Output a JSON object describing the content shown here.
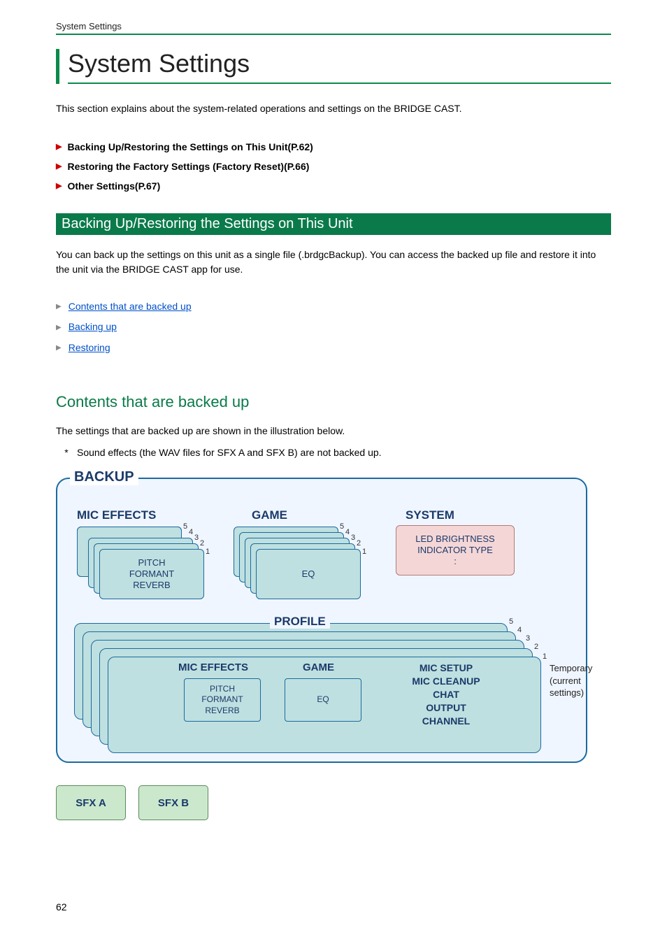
{
  "header": {
    "label": "System Settings"
  },
  "title": "System Settings",
  "intro": "This section explains about the system-related operations and settings on the BRIDGE CAST.",
  "toc": [
    "Backing Up/Restoring the Settings on This Unit(P.62)",
    "Restoring the Factory Settings (Factory Reset)(P.66)",
    "Other Settings(P.67)"
  ],
  "section1": {
    "bar": "Backing Up/Restoring the Settings on This Unit",
    "body": "You can back up the settings on this unit as a single file (.brdgcBackup). You can access the backed up file and restore it into the unit via the BRIDGE CAST app for use.",
    "sublinks": [
      "Contents that are backed up",
      "Backing up",
      "Restoring"
    ]
  },
  "section2": {
    "heading": "Contents that are backed up",
    "body": "The settings that are backed up are shown in the illustration below.",
    "note": "Sound effects (the WAV files for SFX A and SFX B) are not backed up."
  },
  "diagram": {
    "backup_label": "BACKUP",
    "top_groups": {
      "mic_effects": {
        "label": "MIC EFFECTS",
        "card_lines": [
          "PITCH",
          "FORMANT",
          "REVERB"
        ],
        "count": 5
      },
      "game": {
        "label": "GAME",
        "card_lines": [
          "EQ"
        ],
        "count": 5
      },
      "system": {
        "label": "SYSTEM",
        "card_lines": [
          "LED BRIGHTNESS",
          "INDICATOR TYPE",
          ":"
        ]
      }
    },
    "profile": {
      "label": "PROFILE",
      "count": 5,
      "mic_effects": {
        "label": "MIC EFFECTS",
        "card_lines": [
          "PITCH",
          "FORMANT",
          "REVERB"
        ]
      },
      "game": {
        "label": "GAME",
        "card_lines": [
          "EQ"
        ]
      },
      "setup_list": [
        "MIC SETUP",
        "MIC CLEANUP",
        "CHAT",
        "OUTPUT",
        "CHANNEL"
      ],
      "temp_label": "Temporary\n(current settings)"
    },
    "sfx": [
      "SFX A",
      "SFX B"
    ]
  },
  "page_number": "62"
}
